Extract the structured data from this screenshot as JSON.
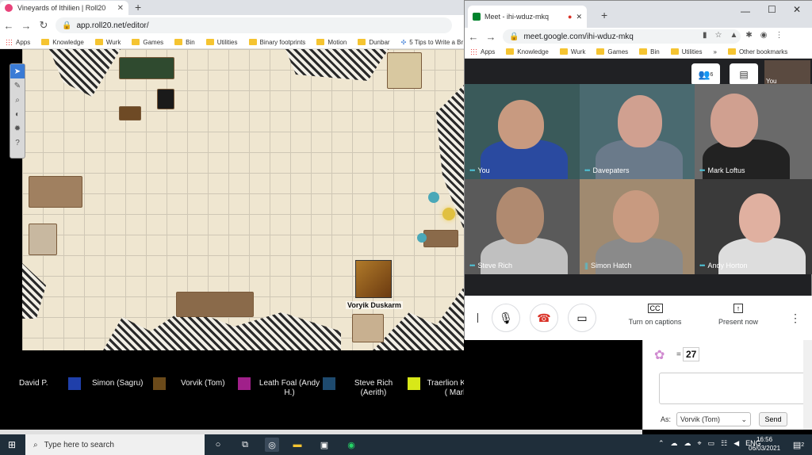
{
  "browser": {
    "tab_title": "Vineyards of Ithilien | Roll20",
    "url": "app.roll20.net/editor/",
    "bookmarks": [
      "Apps",
      "Knowledge",
      "Wurk",
      "Games",
      "Bin",
      "Utilities",
      "Binary footprints",
      "Motion",
      "Dunbar",
      "5 Tips to Write a Br"
    ]
  },
  "roll20": {
    "token_name": "Voryik Duskarm",
    "players": [
      {
        "name": "David P.",
        "color": "#1f3faa"
      },
      {
        "name": "Simon (Sagru)",
        "color": "#6b4a1a"
      },
      {
        "name": "Vorvik (Tom)",
        "color": "#a0208a"
      },
      {
        "name": "Leath Foal (Andy H.)",
        "color": "#1e4a6e"
      },
      {
        "name": "Steve Rich (Aerith)",
        "color": "#d8e818"
      },
      {
        "name": "Traerlion Kelpetor ( Mark )",
        "color": "#8a2aa6"
      }
    ],
    "chat": {
      "roll_result": "27",
      "roll_prefix": "=",
      "as_label": "As:",
      "as_value": "Vorvik (Tom)",
      "send_label": "Send"
    }
  },
  "meet": {
    "tab_title": "Meet - ihi-wduz-mkq",
    "url": "meet.google.com/ihi-wduz-mkq",
    "bookmarks": [
      "Apps",
      "Knowledge",
      "Wurk",
      "Games",
      "Bin",
      "Utilities"
    ],
    "other_bookmarks": "Other bookmarks",
    "self_label": "You",
    "participant_count": "6",
    "participants": [
      {
        "name": "You"
      },
      {
        "name": "Davepaters"
      },
      {
        "name": "Mark Loftus"
      },
      {
        "name": "Steve Rich"
      },
      {
        "name": "Simon Hatch"
      },
      {
        "name": "Andy Horton"
      }
    ],
    "captions_label": "Turn on captions",
    "present_label": "Present now"
  },
  "taskbar": {
    "search_placeholder": "Type here to search",
    "language": "ENG",
    "time": "16:56",
    "date": "06/03/2021",
    "notification_count": "2"
  }
}
